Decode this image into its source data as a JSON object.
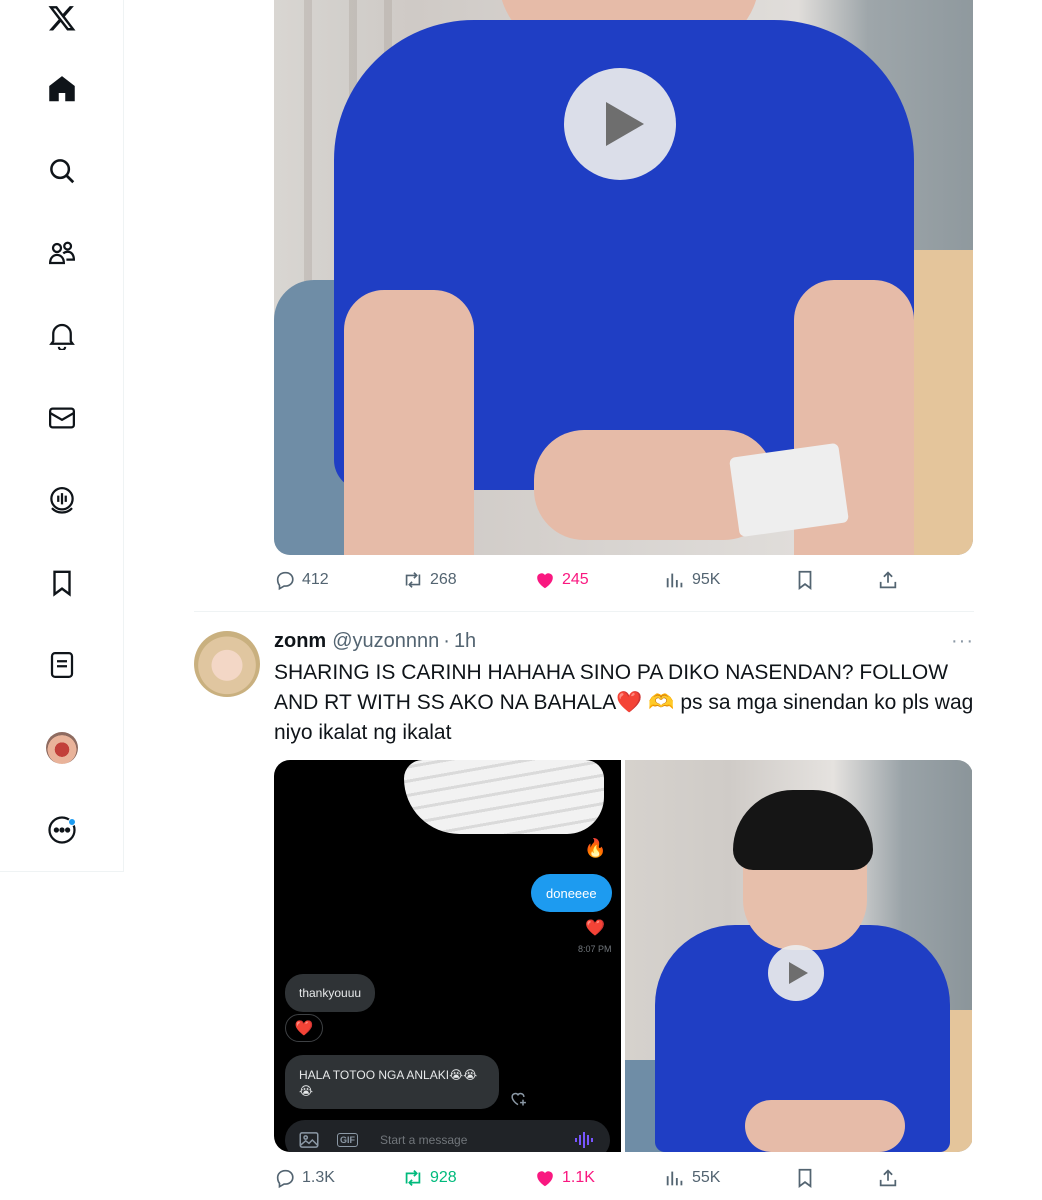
{
  "nav": {
    "items": [
      {
        "name": "x-logo",
        "icon": "x-logo-icon"
      },
      {
        "name": "home",
        "icon": "home-icon"
      },
      {
        "name": "explore",
        "icon": "search-icon"
      },
      {
        "name": "communities",
        "icon": "people-icon"
      },
      {
        "name": "notifications",
        "icon": "bell-icon"
      },
      {
        "name": "messages",
        "icon": "mail-icon"
      },
      {
        "name": "grok",
        "icon": "spaces-icon"
      },
      {
        "name": "bookmarks",
        "icon": "bookmark-icon"
      },
      {
        "name": "lists",
        "icon": "list-icon"
      },
      {
        "name": "profile",
        "icon": "avatar"
      },
      {
        "name": "more",
        "icon": "more-circle-icon"
      }
    ]
  },
  "tweet_prev": {
    "stats": {
      "replies": "412",
      "reposts": "268",
      "likes": "245",
      "views": "95K"
    }
  },
  "tweet": {
    "name": "zonm",
    "handle": "@yuzonnnn",
    "separator": "·",
    "time": "1h",
    "more": "···",
    "text_part1": "SHARING IS CARINH HAHAHA SINO PA DIKO NASENDAN? FOLLOW AND RT WITH SS AKO NA BAHALA",
    "emoji_heart": "❤️",
    "emoji_hands": "🫶",
    "text_part2": " ps sa mga sinendan ko pls wag niyo ikalat ng ikalat",
    "stats": {
      "replies": "1.3K",
      "reposts": "928",
      "likes": "1.1K",
      "views": "55K"
    }
  },
  "dm_screenshot": {
    "fire": "🔥",
    "outgoing_message": "doneeee",
    "outgoing_reaction": "❤️",
    "timestamp": "8:07 PM",
    "incoming_message_1": "thankyouuu",
    "incoming_reaction": "❤️",
    "incoming_message_2": "HALA TOTOO NGA ANLAKI😭😭😭",
    "composer_gif": "GIF",
    "composer_placeholder": "Start a message"
  },
  "colors": {
    "like": "#f91880",
    "repost": "#00ba7c",
    "muted": "#536471",
    "accent": "#1d9bf0"
  }
}
